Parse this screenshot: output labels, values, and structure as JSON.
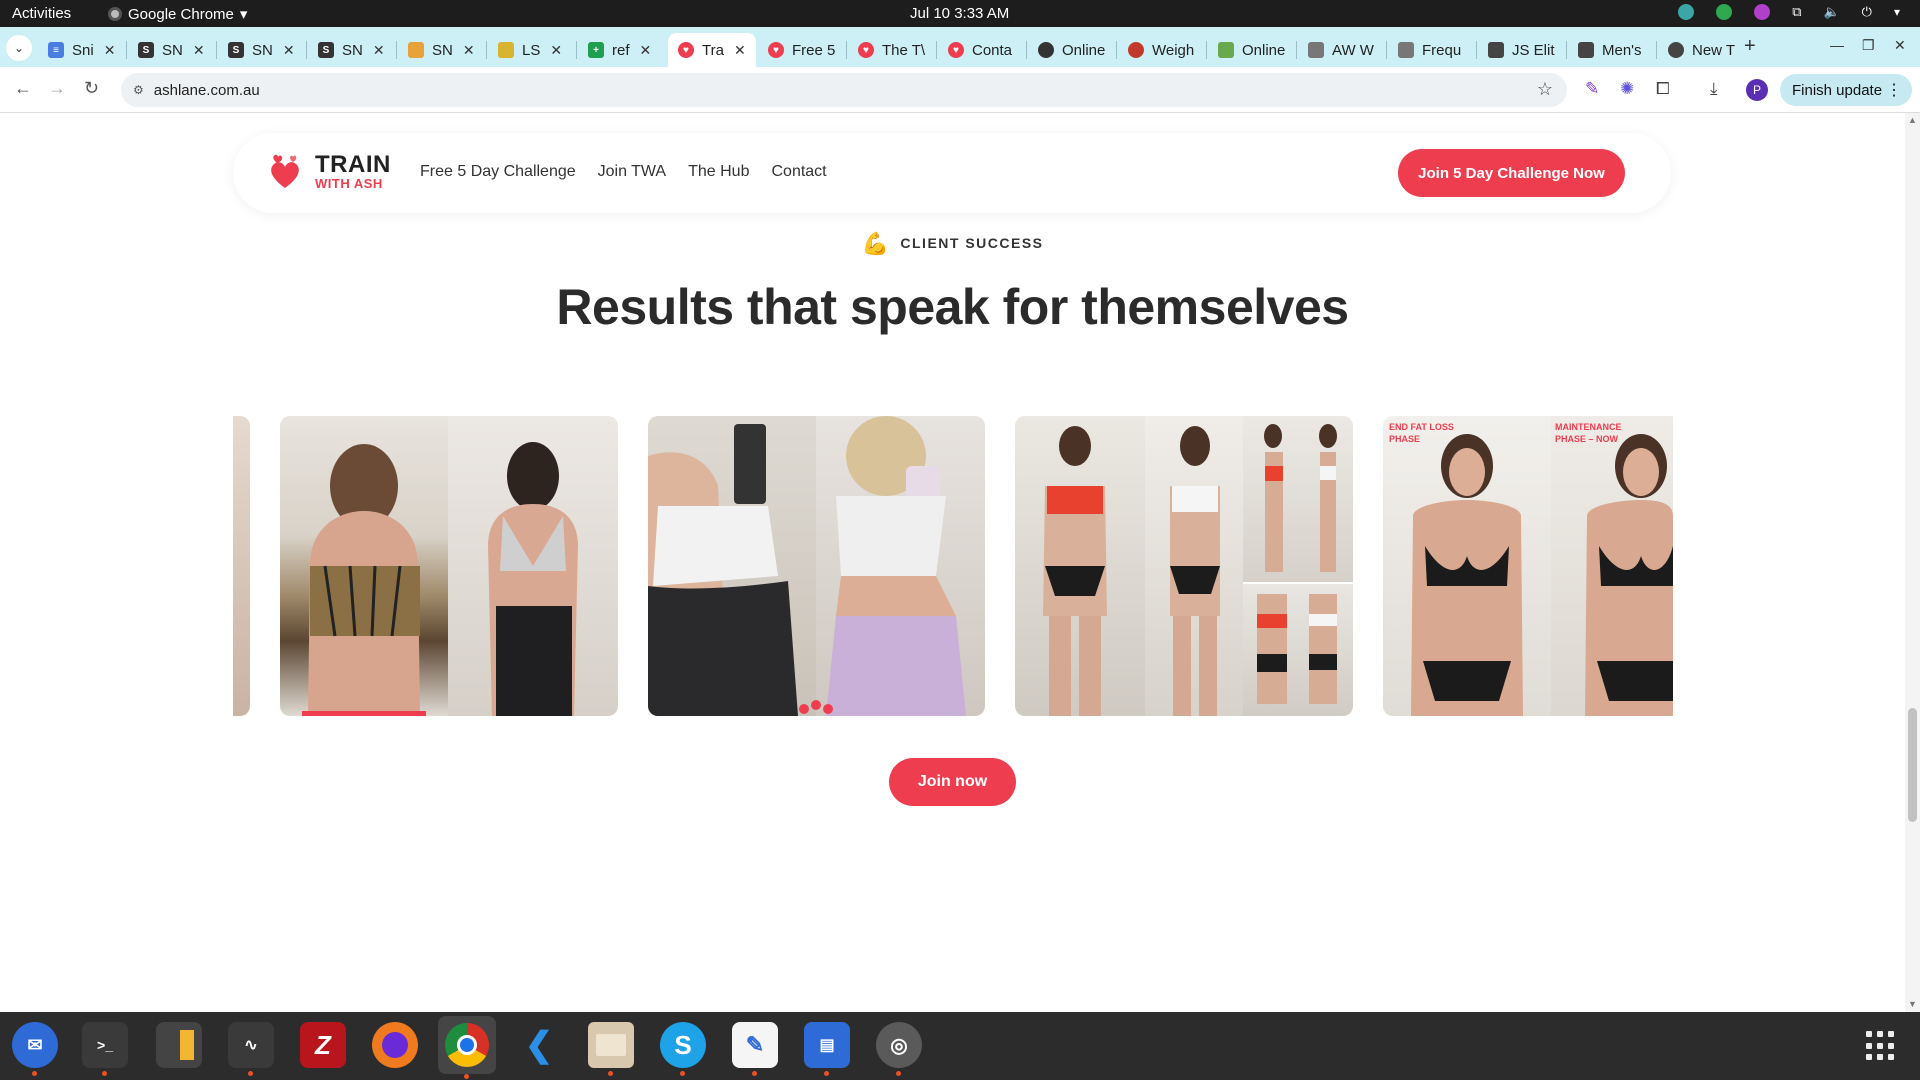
{
  "os": {
    "activities": "Activities",
    "app_name": "Google Chrome",
    "clock": "Jul 10  3:33 AM"
  },
  "tabs": [
    {
      "label": "Sni",
      "fav_color": "#4a7de2"
    },
    {
      "label": "SN",
      "fav_color": "#333333"
    },
    {
      "label": "SN",
      "fav_color": "#333333"
    },
    {
      "label": "SN",
      "fav_color": "#333333"
    },
    {
      "label": "SN",
      "fav_color": "#e9a23b"
    },
    {
      "label": "LS",
      "fav_color": "#d8b430"
    },
    {
      "label": "ref",
      "fav_color": "#1e9e4f"
    },
    {
      "label": "Tra",
      "fav_color": "#ee3d4f"
    },
    {
      "label": "Free 5",
      "fav_color": "#ee3d4f"
    },
    {
      "label": "The T\\",
      "fav_color": "#ee3d4f"
    },
    {
      "label": "Conta",
      "fav_color": "#ee3d4f"
    },
    {
      "label": "Online",
      "fav_color": "#333333"
    },
    {
      "label": "Weigh",
      "fav_color": "#c0392b"
    },
    {
      "label": "Online",
      "fav_color": "#6aa84f"
    },
    {
      "label": "AW W",
      "fav_color": "#555555"
    },
    {
      "label": "Frequ",
      "fav_color": "#555555"
    },
    {
      "label": "JS Elit",
      "fav_color": "#444444"
    },
    {
      "label": "Men's",
      "fav_color": "#444444"
    },
    {
      "label": "New T",
      "fav_color": "#444444"
    }
  ],
  "toolbar": {
    "url": "ashlane.com.au",
    "finish_update": "Finish update",
    "profile_initial": "P"
  },
  "site": {
    "logo_line1": "TRAIN",
    "logo_line2": "WITH ASH",
    "nav": [
      "Free 5 Day Challenge",
      "Join TWA",
      "The Hub",
      "Contact"
    ],
    "cta": "Join 5 Day Challenge Now"
  },
  "section": {
    "eyebrow": "CLIENT SUCCESS",
    "eyebrow_icon": "flexed-biceps-icon",
    "heading": "Results that speak for themselves",
    "join_button": "Join now"
  },
  "cards": [
    {
      "label_left": "",
      "label_right": ""
    },
    {
      "label_left": "",
      "label_right": ""
    },
    {
      "label_left": "",
      "label_right": ""
    },
    {
      "label_left": "END FAT LOSS PHASE",
      "label_right": "MAINTENANCE PHASE – NOW"
    }
  ],
  "dock": [
    "thunderbird-icon",
    "terminal-icon",
    "calculator-icon",
    "system-monitor-icon",
    "filezilla-icon",
    "firefox-icon",
    "chrome-icon",
    "vscode-icon",
    "files-icon",
    "skype-icon",
    "text-editor-icon",
    "libreoffice-writer-icon",
    "disk-icon"
  ],
  "colors": {
    "brand_red": "#ee3d4f",
    "tab_strip": "#cdeff6"
  }
}
